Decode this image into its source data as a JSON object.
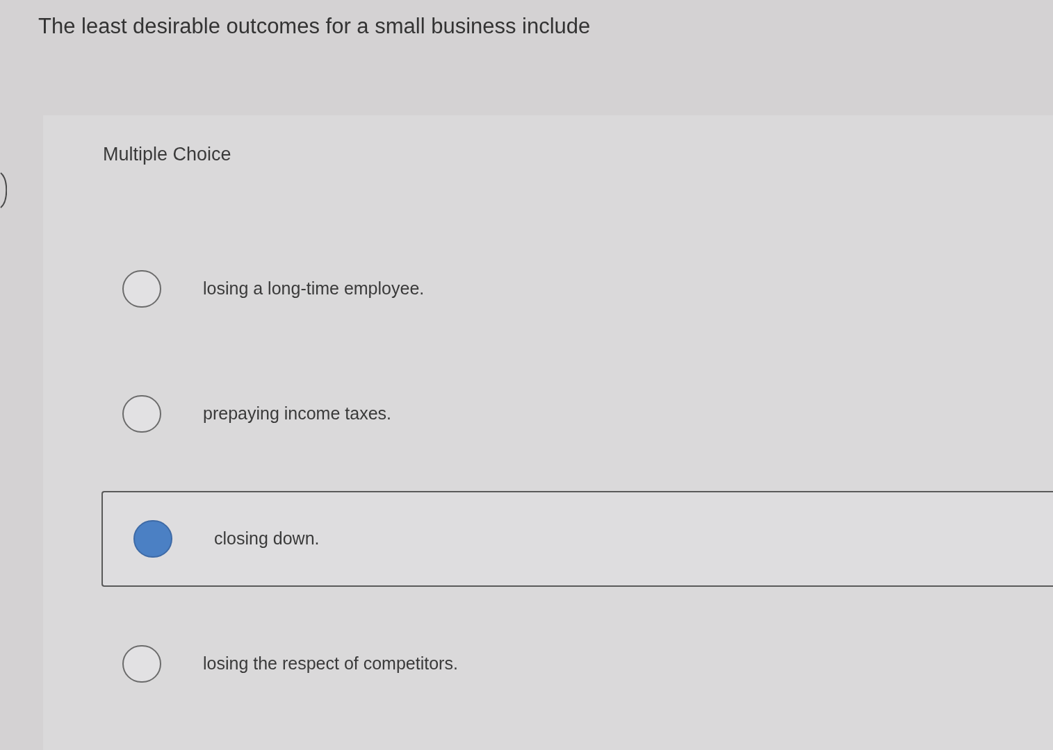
{
  "question": {
    "text": "The least desirable outcomes for a small business include"
  },
  "format_label": "Multiple Choice",
  "options": [
    {
      "label": "losing a long-time employee.",
      "selected": false
    },
    {
      "label": "prepaying income taxes.",
      "selected": false
    },
    {
      "label": "closing down.",
      "selected": true
    },
    {
      "label": "losing the respect of competitors.",
      "selected": false
    }
  ]
}
